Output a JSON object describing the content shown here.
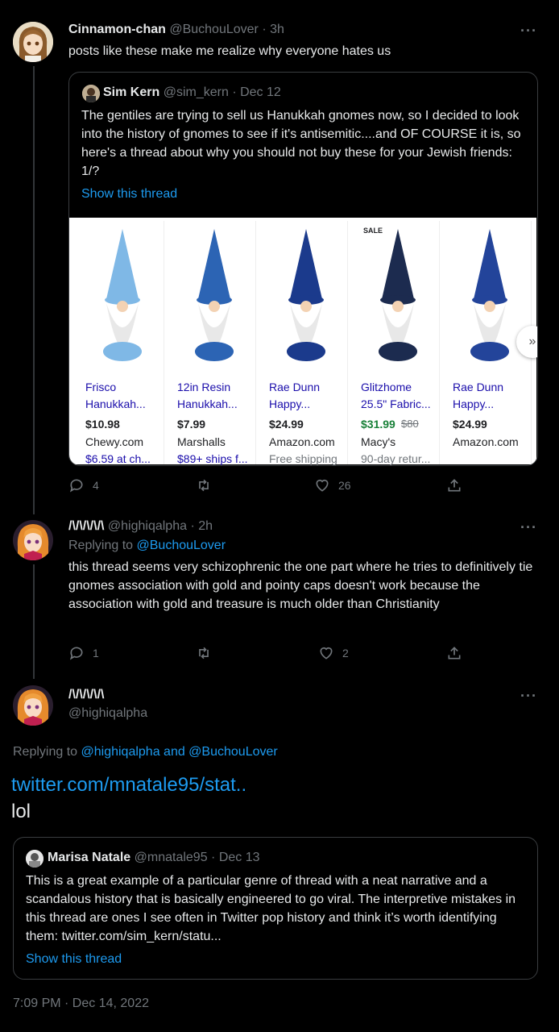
{
  "tweet1": {
    "name": "Cinnamon-chan",
    "handle": "@BuchouLover",
    "time": "· 3h",
    "text": "posts like these make me realize why everyone hates us",
    "quote": {
      "name": "Sim Kern",
      "handle": "@sim_kern",
      "date": "· Dec 12",
      "text": "The gentiles are trying to sell us Hanukkah gnomes now, so I decided to look into the history of gnomes to see if it's antisemitic....and OF COURSE it is, so here's a thread about why you should not buy these for your Jewish friends: 1/?",
      "show_thread": "Show this thread",
      "products": [
        {
          "title1": "Frisco",
          "title2": "Hanukkah...",
          "price": "$10.98",
          "old_price": "",
          "store": "Chewy.com",
          "shipping": "$6.59 at ch...",
          "shipping_color": "#1a0dab",
          "hat": "#7fb8e6",
          "hat_icon": "stripe-gnome"
        },
        {
          "title1": "12in Resin",
          "title2": "Hanukkah...",
          "price": "$7.99",
          "old_price": "",
          "store": "Marshalls",
          "shipping": "$89+ ships f...",
          "shipping_color": "#1a0dab",
          "hat": "#2c64b4",
          "hat_icon": "resin-gnome"
        },
        {
          "title1": "Rae Dunn",
          "title2": "Happy...",
          "price": "$24.99",
          "old_price": "",
          "store": "Amazon.com",
          "shipping": "Free shipping",
          "shipping_color": "#70757a",
          "hat": "#1b3a8c",
          "hat_icon": "gray-beard-gnome"
        },
        {
          "title1": "Glitzhome",
          "title2": "25.5\" Fabric...",
          "price": "$31.99",
          "old_price": "$80",
          "store": "Macy's",
          "shipping": "90-day retur...",
          "shipping_color": "#70757a",
          "hat": "#1c2b4f",
          "hat_icon": "sale-gnome",
          "sale": "SALE",
          "price_color": "#188038"
        },
        {
          "title1": "Rae Dunn",
          "title2": "Happy...",
          "price": "$24.99",
          "old_price": "",
          "store": "Amazon.com",
          "shipping": "",
          "shipping_color": "#70757a",
          "hat": "#23449a",
          "hat_icon": "dreidel-gnome"
        }
      ]
    },
    "actions": {
      "replies": "4",
      "retweets": "",
      "likes": "26"
    }
  },
  "tweet2": {
    "name": "/\\/\\/\\/\\/\\",
    "handle": "@highiqalpha",
    "time": "· 2h",
    "replying_label": "Replying to",
    "replying_to": "@BuchouLover",
    "text": "this thread seems very schizophrenic the one part where he tries to definitively tie gnomes association with gold and pointy caps doesn't work because the association with gold and treasure is much older than Christianity",
    "actions": {
      "replies": "1",
      "retweets": "",
      "likes": "2"
    }
  },
  "tweet3": {
    "name": "/\\/\\/\\/\\/\\",
    "handle": "@highiqalpha",
    "replying_label": "Replying to",
    "replying_to": "@highiqalpha and @BuchouLover",
    "link": "twitter.com/mnatale95/stat..",
    "text": "lol",
    "quote": {
      "name": "Marisa Natale",
      "handle": "@mnatale95",
      "date": "· Dec 13",
      "text": "This is a great example of a particular genre of thread with a neat narrative and a scandalous history that is basically engineered to go viral. The interpretive mistakes in this thread are ones I see often in Twitter pop history and think it’s worth identifying them: twitter.com/sim_kern/statu...",
      "show_thread": "Show this thread"
    },
    "timestamp": "7:09 PM · Dec 14, 2022"
  },
  "more_label": "···",
  "next_label": "»"
}
